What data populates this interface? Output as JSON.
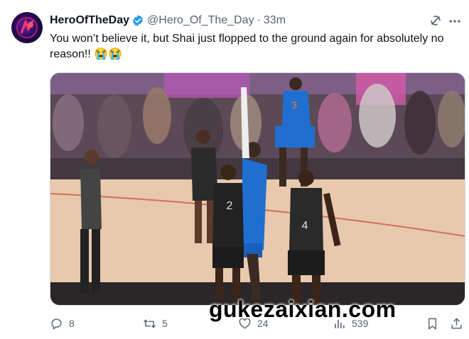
{
  "tweet": {
    "display_name": "HeroOfTheDay",
    "handle": "@Hero_Of_The_Day",
    "separator": "·",
    "time": "33m",
    "text": "You won’t believe it, but Shai just flopped to the ground again for absolutely no reason!! 😭😭",
    "icons": {
      "verified": "verified-badge-icon",
      "grok": "grok-icon",
      "more": "more-options-icon"
    },
    "media": {
      "jersey_numbers": [
        "2",
        "4"
      ]
    }
  },
  "actions": {
    "replies": "8",
    "reposts": "5",
    "likes": "24",
    "views": "539"
  },
  "watermark": "gukezaixian.com",
  "colors": {
    "verified_blue": "#1d9bf0",
    "muted_text": "#536471",
    "court": "#e8c9ad",
    "thunder_blue": "#1f6fd1",
    "spurs_black": "#222222"
  }
}
